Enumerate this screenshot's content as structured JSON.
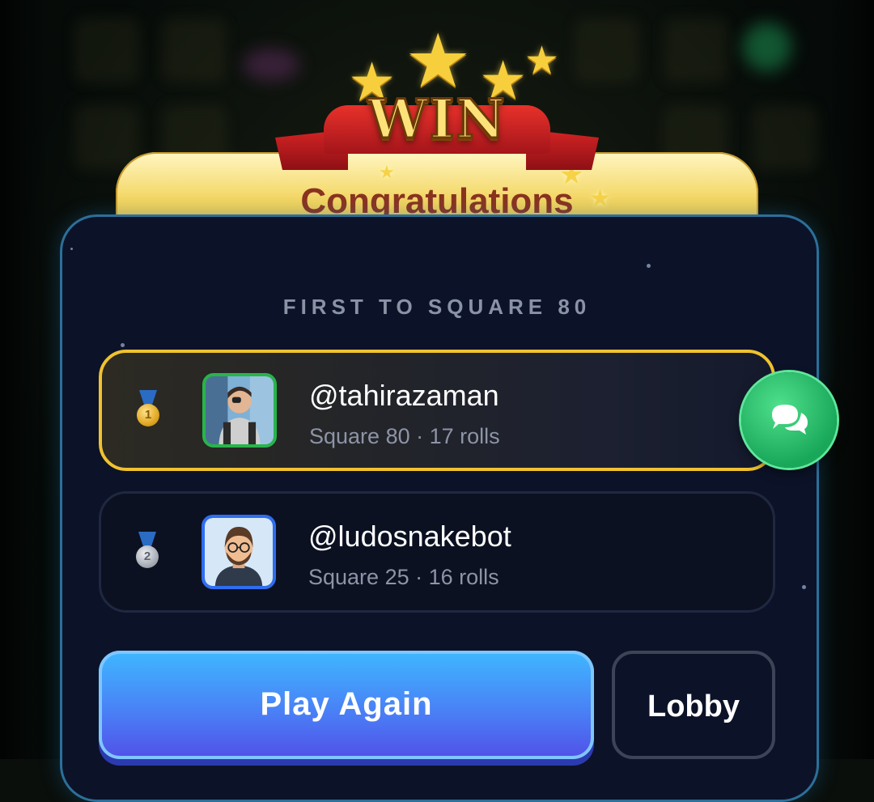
{
  "banner": {
    "badge_text": "WIN",
    "title": "Congratulations"
  },
  "result": {
    "subtitle": "FIRST TO SQUARE 80"
  },
  "players": [
    {
      "rank": "1",
      "medal": "gold-medal-icon",
      "username": "@tahirazaman",
      "stats": "Square 80 · 17 rolls",
      "frame_color": "#28b44a"
    },
    {
      "rank": "2",
      "medal": "silver-medal-icon",
      "username": "@ludosnakebot",
      "stats": "Square 25 · 16 rolls",
      "frame_color": "#2f6df0"
    }
  ],
  "chat": {
    "icon": "chat-bubbles-icon"
  },
  "actions": {
    "play_again": "Play Again",
    "lobby": "Lobby"
  },
  "colors": {
    "winner_border": "#f0c22f",
    "card_border": "#2c6f9a",
    "play_button": "#4a7cf5",
    "chat_button": "#19a85a"
  }
}
